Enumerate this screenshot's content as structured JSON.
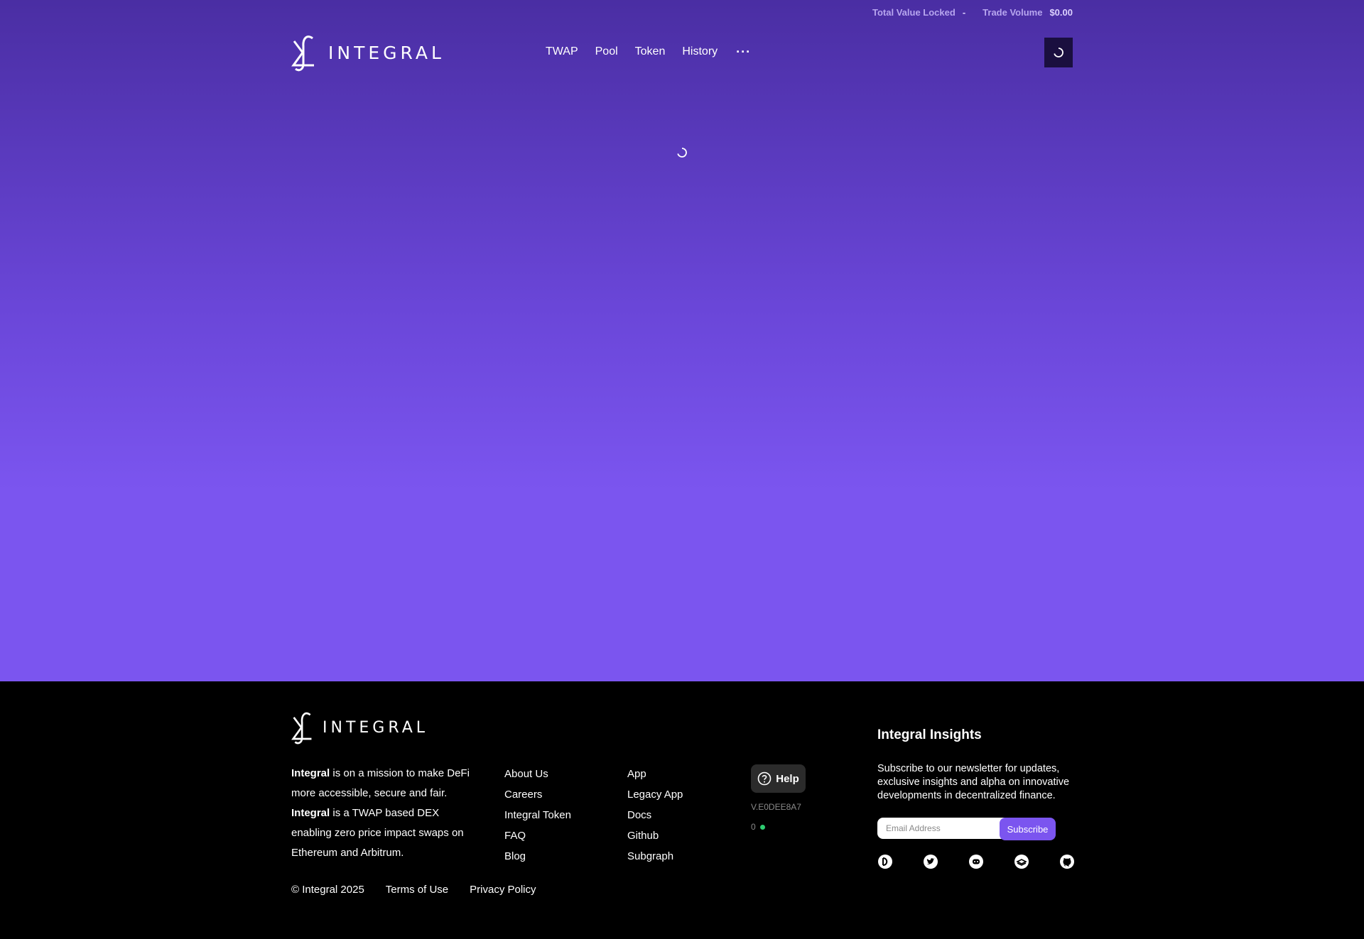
{
  "topbar": {
    "tvl_label": "Total Value Locked",
    "tvl_value": "-",
    "volume_label": "Trade Volume",
    "volume_value": "$0.00"
  },
  "brand": {
    "name": "INTEGRAL"
  },
  "nav": {
    "items": [
      {
        "label": "TWAP"
      },
      {
        "label": "Pool"
      },
      {
        "label": "Token"
      },
      {
        "label": "History"
      }
    ],
    "more": "···"
  },
  "footer": {
    "mission": {
      "brand1": "Integral",
      "text1": " is on a mission to make DeFi more accessible, secure and fair.",
      "brand2": "Integral",
      "text2": " is a TWAP based DEX enabling zero price impact swaps on Ethereum and Arbitrum."
    },
    "col1": [
      "About Us",
      "Careers",
      "Integral Token",
      "FAQ",
      "Blog"
    ],
    "col2": [
      "App",
      "Legacy App",
      "Docs",
      "Github",
      "Subgraph"
    ],
    "help_label": "Help",
    "version": "V.E0DEE8A7",
    "status_count": "0",
    "insights": {
      "title": "Integral Insights",
      "text": "Subscribe to our newsletter for updates, exclusive insights and alpha on innovative developments in decentralized finance.",
      "email_placeholder": "Email Address",
      "subscribe_label": "Subscribe"
    },
    "social_icons": [
      "mirror-icon",
      "twitter-icon",
      "discord-icon",
      "gitbook-icon",
      "github-icon"
    ],
    "legal": {
      "copyright": "© Integral 2025",
      "terms": "Terms of Use",
      "privacy": "Privacy Policy"
    }
  },
  "colors": {
    "gradient_top": "#4a2ea3",
    "gradient_bottom": "#7b55ef",
    "accent": "#7b55ef",
    "footer_bg": "#000000",
    "status_ok": "#2ecc71"
  }
}
